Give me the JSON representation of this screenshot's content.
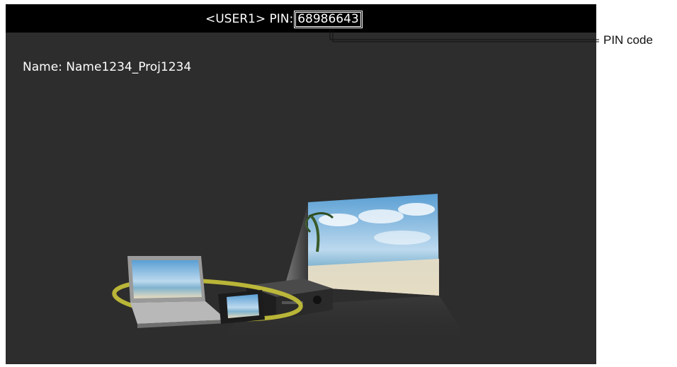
{
  "header": {
    "user_prefix": "<USER1> PIN:",
    "pin_value": "68986643"
  },
  "device": {
    "name_line": "Name: Name1234_Proj1234"
  },
  "callout": {
    "label": "PIN code"
  },
  "illustration": {
    "description_icon": "wireless-projection-illustration"
  },
  "colors": {
    "screen_bg": "#2d2d2d",
    "topbar_bg": "#000000",
    "ring": "#c9c43a"
  }
}
